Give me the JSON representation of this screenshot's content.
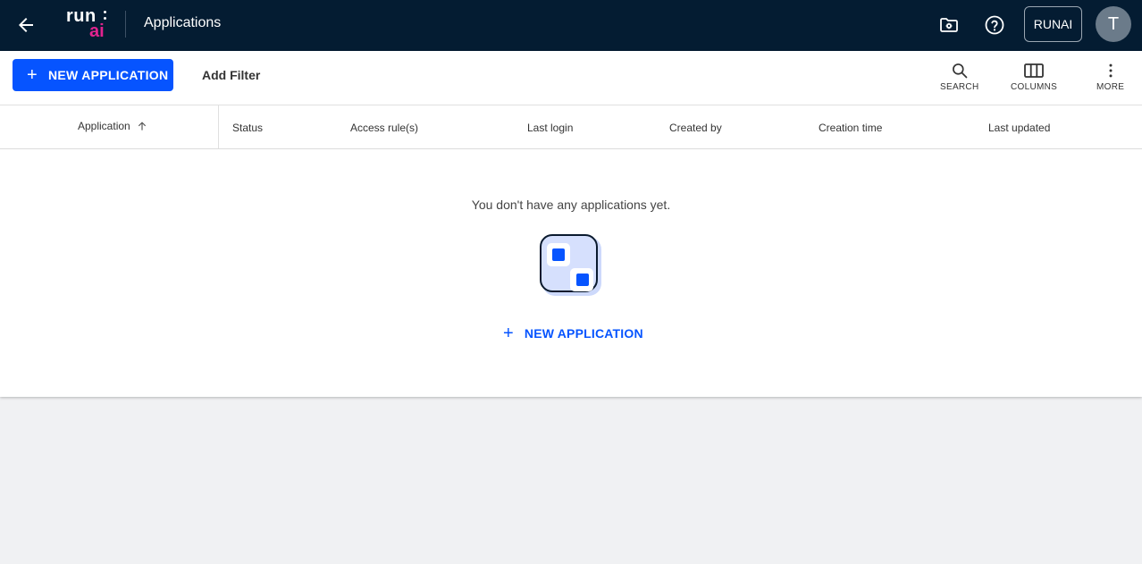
{
  "topbar": {
    "logo_run": "run",
    "logo_ai": "ai",
    "title": "Applications",
    "tenant_label": "RUNAI",
    "avatar_initial": "T",
    "background": "#041c32"
  },
  "toolbar": {
    "new_application_label": "NEW APPLICATION",
    "add_filter_label": "Add Filter",
    "search_label": "SEARCH",
    "columns_label": "COLUMNS",
    "more_label": "MORE",
    "accent": "#0654ff"
  },
  "table": {
    "columns": [
      "Application",
      "Status",
      "Access rule(s)",
      "Last login",
      "Created by",
      "Creation time",
      "Last updated"
    ],
    "sorted_column": "Application",
    "sort_direction": "ascending"
  },
  "empty_state": {
    "message": "You don't have any applications yet.",
    "action_label": "NEW APPLICATION"
  }
}
